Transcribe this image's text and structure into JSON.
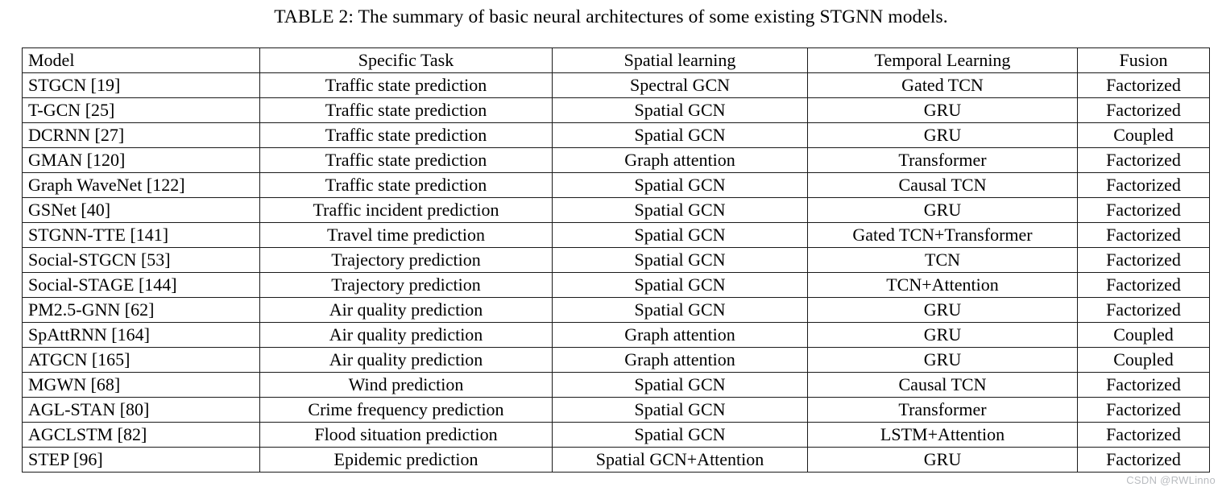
{
  "caption": "TABLE 2: The summary of basic neural architectures of some existing STGNN models.",
  "watermark": "CSDN @RWLinno",
  "table": {
    "columns": [
      {
        "key": "model",
        "label": "Model",
        "align": "left"
      },
      {
        "key": "task",
        "label": "Specific Task",
        "align": "center"
      },
      {
        "key": "spatial",
        "label": "Spatial learning",
        "align": "center"
      },
      {
        "key": "temporal",
        "label": "Temporal Learning",
        "align": "center"
      },
      {
        "key": "fusion",
        "label": "Fusion",
        "align": "center"
      }
    ],
    "rows": [
      {
        "model": "STGCN [19]",
        "task": "Traffic state prediction",
        "spatial": "Spectral GCN",
        "temporal": "Gated TCN",
        "fusion": "Factorized"
      },
      {
        "model": "T-GCN [25]",
        "task": "Traffic state prediction",
        "spatial": "Spatial GCN",
        "temporal": "GRU",
        "fusion": "Factorized"
      },
      {
        "model": "DCRNN [27]",
        "task": "Traffic state prediction",
        "spatial": "Spatial GCN",
        "temporal": "GRU",
        "fusion": "Coupled"
      },
      {
        "model": "GMAN [120]",
        "task": "Traffic state prediction",
        "spatial": "Graph attention",
        "temporal": "Transformer",
        "fusion": "Factorized"
      },
      {
        "model": "Graph WaveNet [122]",
        "task": "Traffic state prediction",
        "spatial": "Spatial GCN",
        "temporal": "Causal TCN",
        "fusion": "Factorized"
      },
      {
        "model": "GSNet [40]",
        "task": "Traffic incident prediction",
        "spatial": "Spatial GCN",
        "temporal": "GRU",
        "fusion": "Factorized"
      },
      {
        "model": "STGNN-TTE [141]",
        "task": "Travel time prediction",
        "spatial": "Spatial GCN",
        "temporal": "Gated TCN+Transformer",
        "fusion": "Factorized"
      },
      {
        "model": "Social-STGCN [53]",
        "task": "Trajectory prediction",
        "spatial": "Spatial GCN",
        "temporal": "TCN",
        "fusion": "Factorized"
      },
      {
        "model": "Social-STAGE [144]",
        "task": "Trajectory prediction",
        "spatial": "Spatial GCN",
        "temporal": "TCN+Attention",
        "fusion": "Factorized"
      },
      {
        "model": "PM2.5-GNN [62]",
        "task": "Air quality prediction",
        "spatial": "Spatial GCN",
        "temporal": "GRU",
        "fusion": "Factorized"
      },
      {
        "model": "SpAttRNN [164]",
        "task": "Air quality prediction",
        "spatial": "Graph attention",
        "temporal": "GRU",
        "fusion": "Coupled"
      },
      {
        "model": "ATGCN [165]",
        "task": "Air quality prediction",
        "spatial": "Graph attention",
        "temporal": "GRU",
        "fusion": "Coupled"
      },
      {
        "model": "MGWN [68]",
        "task": "Wind prediction",
        "spatial": "Spatial GCN",
        "temporal": "Causal TCN",
        "fusion": "Factorized"
      },
      {
        "model": "AGL-STAN [80]",
        "task": "Crime frequency prediction",
        "spatial": "Spatial GCN",
        "temporal": "Transformer",
        "fusion": "Factorized"
      },
      {
        "model": "AGCLSTM [82]",
        "task": "Flood situation prediction",
        "spatial": "Spatial GCN",
        "temporal": "LSTM+Attention",
        "fusion": "Factorized"
      },
      {
        "model": "STEP [96]",
        "task": "Epidemic prediction",
        "spatial": "Spatial GCN+Attention",
        "temporal": "GRU",
        "fusion": "Factorized"
      }
    ]
  }
}
